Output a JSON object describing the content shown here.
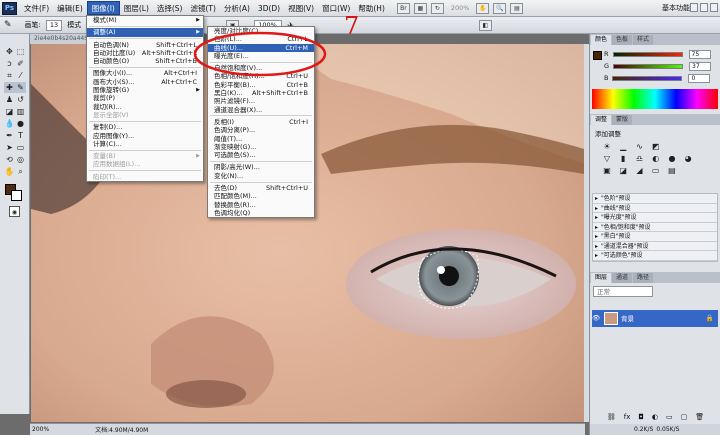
{
  "menubar": {
    "logo": "Ps",
    "items": [
      "文件(F)",
      "编辑(E)",
      "图像(I)",
      "图层(L)",
      "选择(S)",
      "滤镜(T)",
      "分析(A)",
      "3D(D)",
      "视图(V)",
      "窗口(W)",
      "帮助(H)"
    ],
    "zoom": "100%",
    "zoom2": "200%",
    "workspace": "基本功能"
  },
  "options": {
    "brush_label": "画笔:",
    "brush_size": "13",
    "mode_label": "模式"
  },
  "document": {
    "tab": "2ie4e0b4s20a44S...",
    "status_zoom": "200%",
    "status_doc": "文档:4.90M/4.90M"
  },
  "image_menu": [
    {
      "label": "模式(M)",
      "sub": true
    },
    {
      "sep": true
    },
    {
      "label": "调整(A)",
      "sub": true,
      "hl": true
    },
    {
      "sep": true
    },
    {
      "label": "自动色调(N)",
      "sc": "Shift+Ctrl+L"
    },
    {
      "label": "自动对比度(U)",
      "sc": "Alt+Shift+Ctrl+L"
    },
    {
      "label": "自动颜色(O)",
      "sc": "Shift+Ctrl+B"
    },
    {
      "sep": true
    },
    {
      "label": "图像大小(I)...",
      "sc": "Alt+Ctrl+I"
    },
    {
      "label": "画布大小(S)...",
      "sc": "Alt+Ctrl+C"
    },
    {
      "label": "图像旋转(G)",
      "sub": true
    },
    {
      "label": "裁剪(P)"
    },
    {
      "label": "裁切(R)..."
    },
    {
      "label": "显示全部(V)",
      "dis": true
    },
    {
      "sep": true
    },
    {
      "label": "复制(D)..."
    },
    {
      "label": "应用图像(Y)..."
    },
    {
      "label": "计算(C)..."
    },
    {
      "sep": true
    },
    {
      "label": "变量(B)",
      "sub": true,
      "dis": true
    },
    {
      "label": "应用数据组(L)...",
      "dis": true
    },
    {
      "sep": true
    },
    {
      "label": "陷印(T)...",
      "dis": true
    }
  ],
  "adjust_menu": [
    {
      "label": "亮度/对比度(C)..."
    },
    {
      "label": "色阶(L)...",
      "sc": "Ctrl+L"
    },
    {
      "label": "曲线(U)...",
      "sc": "Ctrl+M",
      "hl": true
    },
    {
      "label": "曝光度(E)..."
    },
    {
      "sep": true
    },
    {
      "label": "自然饱和度(V)..."
    },
    {
      "label": "色相/饱和度(H)...",
      "sc": "Ctrl+U"
    },
    {
      "label": "色彩平衡(B)...",
      "sc": "Ctrl+B"
    },
    {
      "label": "黑白(K)...",
      "sc": "Alt+Shift+Ctrl+B"
    },
    {
      "label": "照片滤镜(F)..."
    },
    {
      "label": "通道混合器(X)..."
    },
    {
      "sep": true
    },
    {
      "label": "反相(I)",
      "sc": "Ctrl+I"
    },
    {
      "label": "色调分离(P)..."
    },
    {
      "label": "阈值(T)..."
    },
    {
      "label": "渐变映射(G)..."
    },
    {
      "label": "可选颜色(S)..."
    },
    {
      "sep": true
    },
    {
      "label": "阴影/高光(W)..."
    },
    {
      "label": "变化(N)..."
    },
    {
      "sep": true
    },
    {
      "label": "去色(D)",
      "sc": "Shift+Ctrl+U"
    },
    {
      "label": "匹配颜色(M)..."
    },
    {
      "label": "替换颜色(R)..."
    },
    {
      "label": "色调均化(Q)"
    }
  ],
  "annotation": {
    "step": "7"
  },
  "color_panel": {
    "tabs": [
      "颜色",
      "色板",
      "样式"
    ],
    "rows": [
      {
        "ch": "R",
        "val": "75"
      },
      {
        "ch": "G",
        "val": "37"
      },
      {
        "ch": "B",
        "val": "0"
      }
    ],
    "fg": "#4b2500"
  },
  "adjust_panel": {
    "tabs": [
      "调整",
      "蒙版"
    ],
    "title": "添加调整",
    "presets": [
      "\"色阶\"预设",
      "\"曲线\"预设",
      "\"曝光度\"预设",
      "\"色相/饱和度\"预设",
      "\"黑白\"预设",
      "\"通道混合器\"预设",
      "\"可选颜色\"预设"
    ]
  },
  "layers_panel": {
    "tabs": [
      "图层",
      "通道",
      "路径"
    ],
    "blend": "正常",
    "layer_name": "背景"
  },
  "statusbar_right": {
    "net": "0.2K/S",
    "net2": "0.05K/S"
  }
}
